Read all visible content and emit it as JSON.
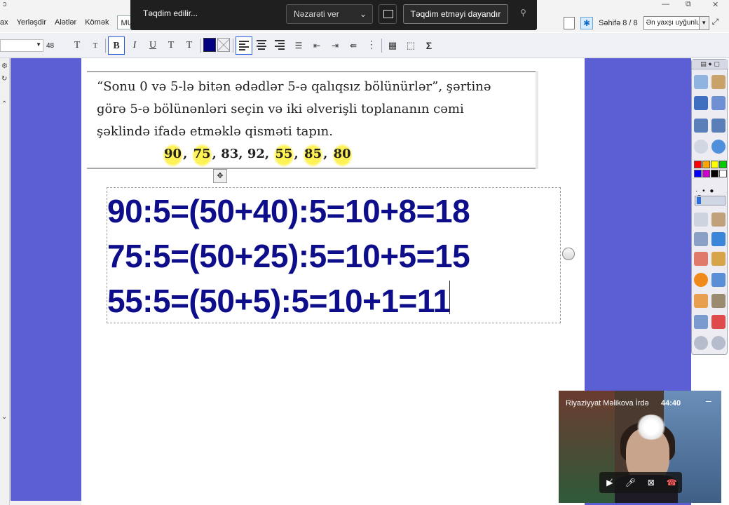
{
  "window": {
    "left_glyph": "ↄ",
    "minimize": "—",
    "restore": "⧉",
    "close": "✕"
  },
  "menu": {
    "items": [
      "ax",
      "Yerləşdir",
      "Alətlər",
      "Kömək"
    ],
    "mu_label": "MU"
  },
  "share_bar": {
    "status": "Təqdim edilir...",
    "control_label": "Nəzarəti ver",
    "stop_label": "Təqdim etməyi dayandır",
    "pin": "⚲"
  },
  "right_tools": {
    "page_label": "Səhifə 8 / 8",
    "fit_option": "Ən yaxşı uyğunluq",
    "dd": "▼",
    "expand": "⤢"
  },
  "format_toolbar": {
    "font_size": "48",
    "dd": "▼",
    "grow": "T",
    "shrink": "T",
    "bold": "B",
    "italic": "I",
    "underline": "U",
    "superscript": "T",
    "subscript": "T",
    "sigma": "Σ"
  },
  "problem": {
    "line1": "“Sonu 0 və 5-lə bitən ədədlər 5-ə qalıqsız bölünürlər”, şərtinə",
    "line2": "görə 5-ə bölünənləri seçin və iki əlverişli toplananın cəmi",
    "line3": "şəklində ifadə etməklə qisməti tapın.",
    "numbers": [
      "90",
      "75",
      "83",
      "92",
      "55",
      "85",
      "80"
    ],
    "sep": ", "
  },
  "move_handle": "✥",
  "solution": {
    "lines": [
      "90:5=(50+40):5=10+8=18",
      "75:5=(50+25):5=10+5=15",
      "55:5=(50+5):5=10+1=11"
    ]
  },
  "palette": {
    "head": "▤ ● ▢",
    "dots": "· • ● ⬤",
    "colors": [
      "#ff0000",
      "#ffa500",
      "#ffff00",
      "#00cc00",
      "#0000ff",
      "#cc00cc",
      "#000000",
      "#ffffff"
    ]
  },
  "video": {
    "name": "Riyaziyyat Məlikova İrdə",
    "time": "44:40",
    "minimize": "–",
    "cam_off": "▶̸",
    "mic": "🎤︎",
    "share": "⊠",
    "hangup": "☎"
  }
}
